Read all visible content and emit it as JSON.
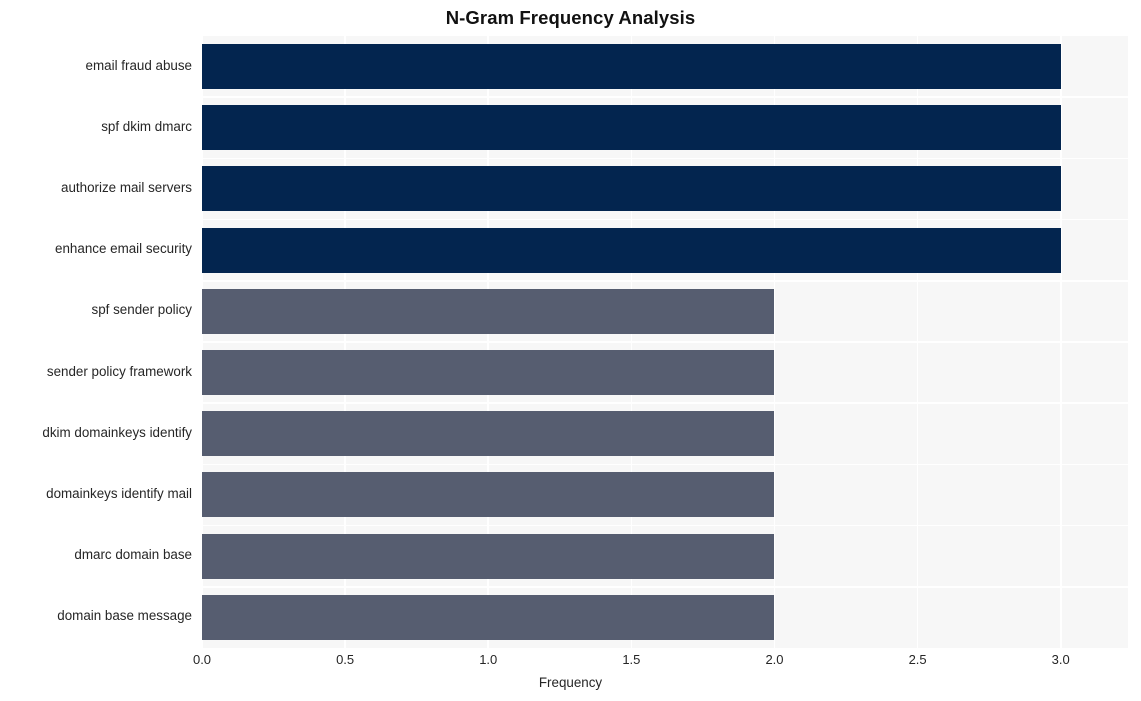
{
  "chart_data": {
    "type": "bar",
    "orientation": "horizontal",
    "title": "N-Gram Frequency Analysis",
    "xlabel": "Frequency",
    "ylabel": "",
    "xlim": [
      0,
      3.235
    ],
    "xticks": [
      "0.0",
      "0.5",
      "1.0",
      "1.5",
      "2.0",
      "2.5",
      "3.0"
    ],
    "xtick_values": [
      0,
      0.5,
      1,
      1.5,
      2,
      2.5,
      3
    ],
    "grid": true,
    "legend": "none",
    "categories": [
      "email fraud abuse",
      "spf dkim dmarc",
      "authorize mail servers",
      "enhance email security",
      "spf sender policy",
      "sender policy framework",
      "dkim domainkeys identify",
      "domainkeys identify mail",
      "dmarc domain base",
      "domain base message"
    ],
    "values": [
      3,
      3,
      3,
      3,
      2,
      2,
      2,
      2,
      2,
      2
    ],
    "bar_colors": [
      "#03254f",
      "#03254f",
      "#03254f",
      "#03254f",
      "#565d70",
      "#565d70",
      "#565d70",
      "#565d70",
      "#565d70",
      "#565d70"
    ],
    "plot_background": "#f7f7f7",
    "gridline_color": "#ffffff",
    "figure_background": "#ffffff"
  }
}
